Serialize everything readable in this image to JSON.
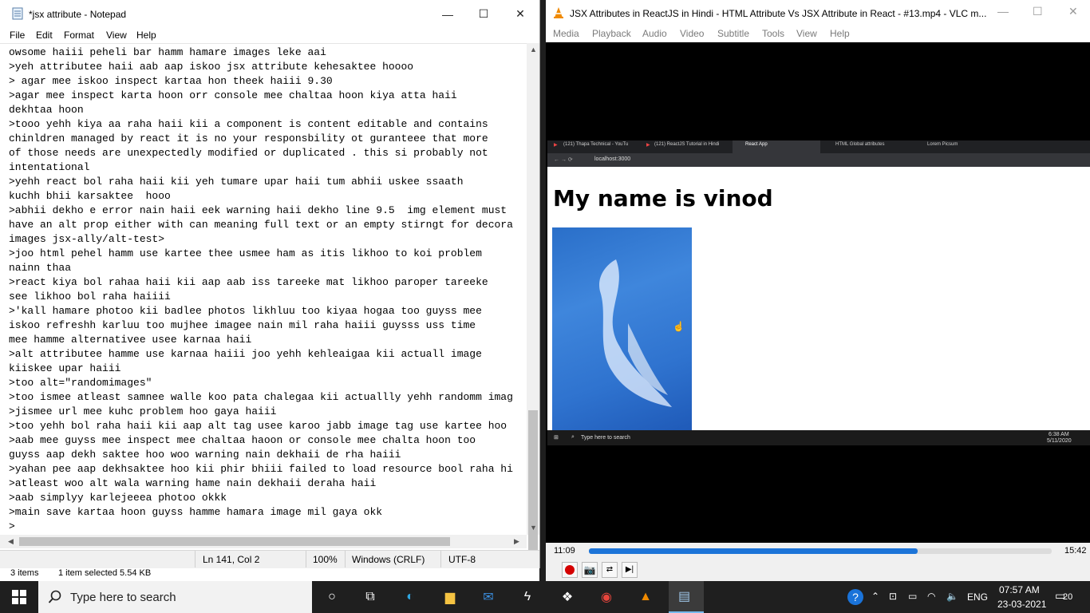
{
  "notepad": {
    "title": "*jsx attribute - Notepad",
    "menu": [
      "File",
      "Edit",
      "Format",
      "View",
      "Help"
    ],
    "lines": [
      "owsome haiii peheli bar hamm hamare images leke aai",
      ">yeh attributee haii aab aap iskoo jsx attribute kehesaktee hoooo",
      "> agar mee iskoo inspect kartaa hon theek haiii 9.30",
      ">agar mee inspect karta hoon orr console mee chaltaa hoon kiya atta haii",
      "dekhtaa hoon",
      ">tooo yehh kiya aa raha haii kii a component is content editable and contains",
      "chinldren managed by react it is no your responsbility ot guranteee that more",
      "of those needs are unexpectedly modified or duplicated . this si probably not",
      "intentational",
      ">yehh react bol raha haii kii yeh tumare upar haii tum abhii uskee ssaath",
      "kuchh bhii karsaktee  hooo",
      ">abhii dekho e error nain haii eek warning haii dekho line 9.5  img element must",
      "have an alt prop either with can meaning full text or an empty stirngt for decora",
      "images jsx-ally/alt-test>",
      ">joo html pehel hamm use kartee thee usmee ham as itis likhoo to koi problem",
      "nainn thaa",
      ">react kiya bol rahaa haii kii aap aab iss tareeke mat likhoo paroper tareeke",
      "see likhoo bol raha haiiii",
      ">'kall hamare photoo kii badlee photos likhluu too kiyaa hogaa too guyss mee",
      "iskoo refreshh karluu too mujhee imagee nain mil raha haiii guysss uss time",
      "mee hamme alternativee usee karnaa haii",
      ">alt attributee hamme use karnaa haiii joo yehh kehleaigaa kii actuall image",
      "kiiskee upar haiii",
      ">too alt=\"randomimages\"",
      ">too ismee atleast samnee walle koo pata chalegaa kii actuallly yehh randomm imag",
      ">jismee url mee kuhc problem hoo gaya haiii",
      ">too yehh bol raha haii kii aap alt tag usee karoo jabb image tag use kartee hoo",
      ">aab mee guyss mee inspect mee chaltaa haoon or console mee chalta hoon too",
      "guyss aap dekh saktee hoo woo warning nain dekhaii de rha haiii",
      ">yahan pee aap dekhsaktee hoo kii phir bhiii failed to load resource bool raha hi",
      ">atleast woo alt wala warning hame nain dekhaii deraha haii",
      ">aab simplyy karlejeeea photoo okkk",
      ">main save kartaa hoon guyss hamme hamara image mil gaya okk",
      ">"
    ],
    "status": {
      "position": "Ln 141, Col 2",
      "zoom": "100%",
      "line_ending": "Windows (CRLF)",
      "encoding": "UTF-8"
    }
  },
  "explorer": {
    "items": "3 items",
    "selected": "1 item selected  5.54 KB"
  },
  "vlc": {
    "title": "JSX Attributes in ReactJS in Hindi - HTML Attribute Vs JSX Attribute in React  - #13.mp4 - VLC m...",
    "menu": [
      "Media",
      "Playback",
      "Audio",
      "Video",
      "Subtitle",
      "Tools",
      "View",
      "Help"
    ],
    "time_elapsed": "11:09",
    "time_total": "15:42",
    "progress": 0.71
  },
  "video": {
    "tabs": [
      "(121) Thapa Technical - YouTu",
      "(121) ReactJS Tutorial in Hindi",
      "React App",
      "HTML Global attributes",
      "Lorem Picsum"
    ],
    "address": "localhost:3000",
    "heading": "My name is vinod",
    "taskbar_search": "Type here to search",
    "clock_time": "6:38 AM",
    "clock_date": "5/11/2020"
  },
  "taskbar": {
    "search_placeholder": "Type here to search",
    "language": "ENG",
    "time": "07:57 AM",
    "date": "23-03-2021",
    "notification_count": "20"
  },
  "colors": {
    "seek_fill": "#1c74d8",
    "taskbar": "#1f1f1f",
    "vlc_orange": "#f08a00"
  }
}
